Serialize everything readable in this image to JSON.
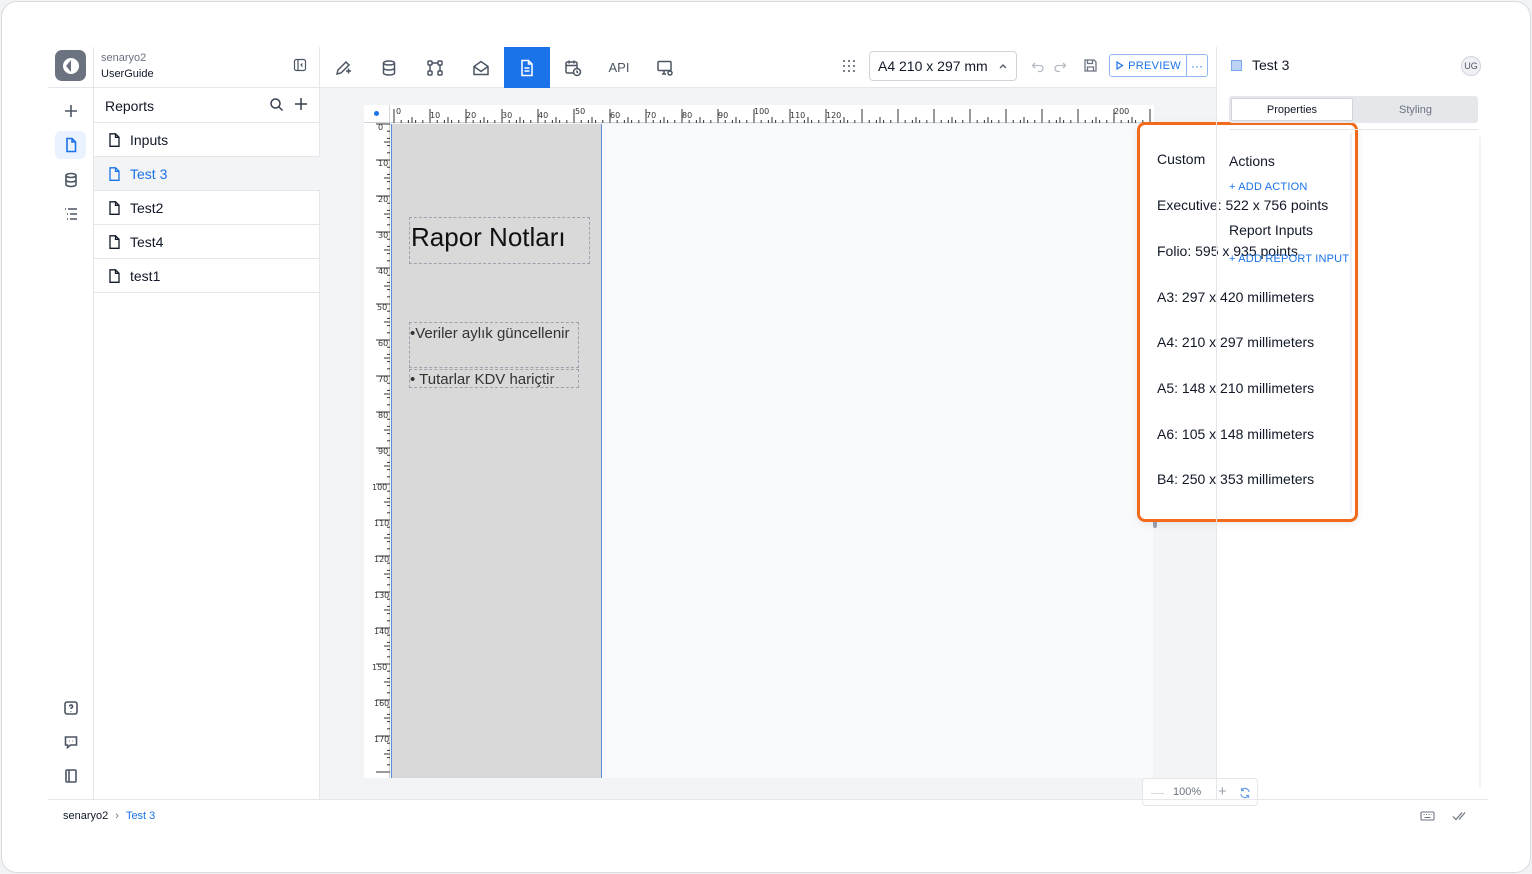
{
  "project": {
    "name": "senaryo2",
    "sub": "UserGuide"
  },
  "reports_panel": {
    "title": "Reports",
    "items": [
      {
        "label": "Inputs"
      },
      {
        "label": "Test 3"
      },
      {
        "label": "Test2"
      },
      {
        "label": "Test4"
      },
      {
        "label": "test1"
      }
    ]
  },
  "toolbar": {
    "api_label": "API",
    "page_size": "A4 210 x 297 mm",
    "preview_label": "PREVIEW",
    "more_label": "···"
  },
  "page_size_menu": {
    "options": [
      "Custom",
      "Executive: 522 x 756 points",
      "Folio: 595 x 935 points",
      "A3: 297 x 420 millimeters",
      "A4: 210 x 297 millimeters",
      "A5: 148 x 210 millimeters",
      "A6: 105 x 148 millimeters",
      "B4: 250 x 353 millimeters"
    ]
  },
  "canvas": {
    "title_text": "Rapor Notları",
    "bullet1": "•Veriler aylık güncellenir",
    "bullet2": "• Tutarlar KDV hariçtir",
    "zoom": "100%",
    "ruler_h_labels": [
      "0",
      "10",
      "20",
      "30",
      "40",
      "50",
      "60",
      "70",
      "80",
      "90",
      "100",
      "110",
      "120",
      "200"
    ],
    "ruler_v_labels": [
      "0",
      "10",
      "20",
      "30",
      "40",
      "50",
      "60",
      "70",
      "80",
      "90",
      "100",
      "110",
      "120",
      "130",
      "140",
      "150",
      "160",
      "170"
    ]
  },
  "right_panel": {
    "title": "Test 3",
    "avatar": "UG",
    "tab_properties": "Properties",
    "tab_styling": "Styling",
    "actions_title": "Actions",
    "add_action": "+ ADD ACTION",
    "inputs_title": "Report Inputs",
    "add_input": "+ ADD REPORT INPUT"
  },
  "footer": {
    "crumb_root": "senaryo2",
    "crumb_current": "Test 3"
  },
  "colors": {
    "accent": "#1a73e8",
    "highlight": "#f26b1d",
    "page_shade": "#d9d9d9"
  }
}
